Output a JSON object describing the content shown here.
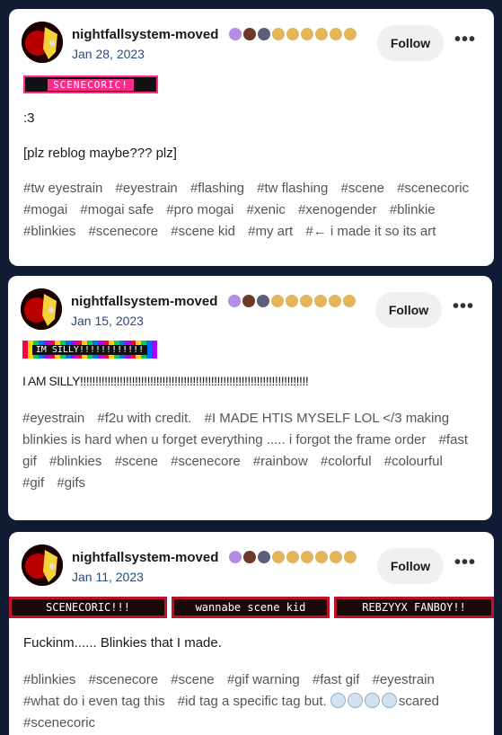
{
  "posts": [
    {
      "username": "nightfallsystem-moved",
      "date": "Jan 28, 2023",
      "follow_label": "Follow",
      "more_label": "•••",
      "blinkies": [
        "SCENECORIC!"
      ],
      "body": [
        ":3",
        "[plz reblog maybe??? plz]"
      ],
      "tags": [
        "#tw eyestrain",
        "#eyestrain",
        "#flashing",
        "#tw flashing",
        "#scene",
        "#scenecoric",
        "#mogai",
        "#mogai safe",
        "#pro mogai",
        "#xenic",
        "#xenogender",
        "#blinkie",
        "#blinkies",
        "#scenecore",
        "#scene kid",
        "#my art",
        "#← i made it so its art"
      ]
    },
    {
      "username": "nightfallsystem-moved",
      "date": "Jan 15, 2023",
      "follow_label": "Follow",
      "more_label": "•••",
      "blinkies": [
        "IM SILLY!!!!!!!!!!!!"
      ],
      "body": [
        "I AM SILLY!!!!!!!!!!!!!!!!!!!!!!!!!!!!!!!!!!!!!!!!!!!!!!!!!!!!!!!!!!!!!!!!!!!!!!!!!!!"
      ],
      "tags": [
        "#eyestrain",
        "#f2u with credit.",
        "#I MADE HTIS MYSELF LOL </3 making blinkies is hard when u forget everything ..... i forgot the frame order",
        "#fast gif",
        "#blinkies",
        "#scene",
        "#scenecore",
        "#rainbow",
        "#colorful",
        "#colourful",
        "#gif",
        "#gifs"
      ]
    },
    {
      "username": "nightfallsystem-moved",
      "date": "Jan 11, 2023",
      "follow_label": "Follow",
      "more_label": "•••",
      "blinkies": [
        "SCENECORIC!!!",
        "wannabe scene kid",
        "REBZYYX FANBOY!!"
      ],
      "body": [
        "Fuckinm...... Blinkies that I made."
      ],
      "tags": [
        "#blinkies",
        "#scenecore",
        "#scene",
        "#gif warning",
        "#fast gif",
        "#eyestrain",
        "#what do i even tag this",
        "#id tag a specific tag but. ",
        "#scenecoric"
      ],
      "tag_emoji_suffix": "scared"
    }
  ]
}
